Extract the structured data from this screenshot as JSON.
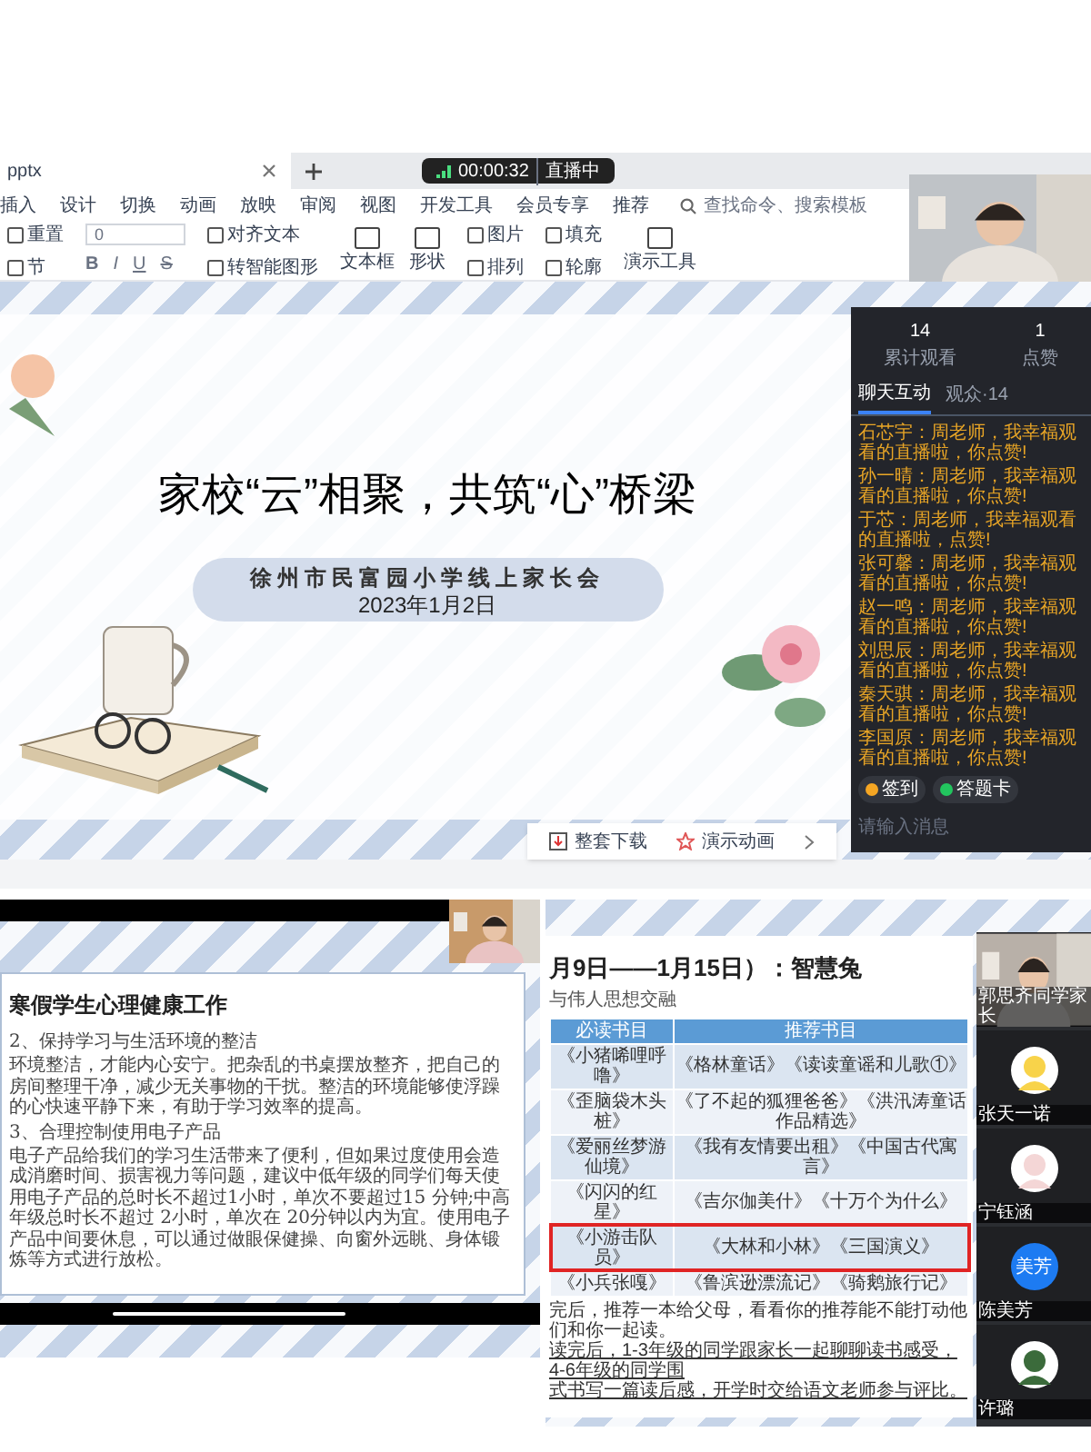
{
  "app": {
    "file_tab": "pptx",
    "live_badge": {
      "time": "00:00:32",
      "status": "直播中"
    },
    "menu": [
      "插入",
      "设计",
      "切换",
      "动画",
      "放映",
      "审阅",
      "视图",
      "开发工具",
      "会员专享",
      "推荐"
    ],
    "search_placeholder": "查找命令、搜索模板",
    "font_size": "0",
    "toolbar": [
      {
        "kind": "group",
        "items": [
          "重置",
          "节"
        ]
      },
      {
        "kind": "format",
        "items": [
          "B",
          "I",
          "U",
          "S"
        ]
      },
      {
        "kind": "group",
        "items": [
          "对齐文本",
          "转智能图形"
        ]
      },
      {
        "kind": "big",
        "items": [
          "文本框",
          "形状"
        ]
      },
      {
        "kind": "group",
        "items": [
          "图片",
          "排列"
        ]
      },
      {
        "kind": "group",
        "items": [
          "填充",
          "轮廓"
        ]
      },
      {
        "kind": "big",
        "items": [
          "演示工具"
        ]
      }
    ],
    "slide": {
      "title": "家校“云”相聚，共筑“心”桥梁",
      "school": "徐州市民富园小学线上家长会",
      "date": "2023年1月2日"
    },
    "slide_actions": [
      "整套下载",
      "演示动画"
    ],
    "live_panel": {
      "stats": [
        {
          "value": "14",
          "label": "累计观看"
        },
        {
          "value": "1",
          "label": "点赞"
        }
      ],
      "tabs": [
        {
          "label": "聊天互动",
          "selected": true
        },
        {
          "label": "观众·14",
          "selected": false
        }
      ],
      "messages": [
        {
          "sender": "石芯宇：",
          "text": "周老师，我幸福观看的直播啦，你点赞!"
        },
        {
          "sender": "孙一晴：",
          "text": "周老师，我幸福观看的直播啦，你点赞!"
        },
        {
          "sender": "于芯：",
          "text": "周老师，我幸福观看的直播啦，点赞!"
        },
        {
          "sender": "张可馨：",
          "text": "周老师，我幸福观看的直播啦，你点赞!"
        },
        {
          "sender": "赵一鸣：",
          "text": "周老师，我幸福观看的直播啦，你点赞!"
        },
        {
          "sender": "刘思辰：",
          "text": "周老师，我幸福观看的直播啦，你点赞!"
        },
        {
          "sender": "秦天骐：",
          "text": "周老师，我幸福观看的直播啦，你点赞!"
        },
        {
          "sender": "李国原：",
          "text": "周老师，我幸福观看的直播啦，你点赞!"
        }
      ],
      "actions": [
        {
          "label": "签到",
          "color": "#f5a623"
        },
        {
          "label": "答题卡",
          "color": "#22c55e"
        }
      ],
      "input_placeholder": "请输入消息"
    }
  },
  "left_share": {
    "title": "寒假学生心理健康工作",
    "sections": [
      {
        "heading": "2、保持学习与生活环境的整洁",
        "body": "环境整洁，才能内心安宁。把杂乱的书桌摆放整齐，把自己的房间整理干净，减少无关事物的干扰。整洁的环境能够使浮躁的心快速平静下来，有助于学习效率的提高。"
      },
      {
        "heading": "3、合理控制使用电子产品",
        "body": "电子产品给我们的学习生活带来了便利，但如果过度使用会造成消磨时间、损害视力等问题，建议中低年级的同学们每天使用电子产品的总时长不超过1小时，单次不要超过15 分钟;中高年级总时长不超过 2小时，单次在 20分钟以内为宜。使用电子产品中间要休息，可以通过做眼保健操、向窗外远眺、身体锻炼等方式进行放松。"
      }
    ]
  },
  "right_share": {
    "title": "月9日——1月15日）：智慧兔",
    "subtitle": "与伟人思想交融",
    "table": {
      "columns": [
        "必读书目",
        "推荐书目"
      ],
      "rows": [
        {
          "required": "《小猪唏哩呼噜》",
          "recommended": "《格林童话》《读读童谣和儿歌①》",
          "highlighted": false
        },
        {
          "required": "《歪脑袋木头桩》",
          "recommended": "《了不起的狐狸爸爸》《洪汛涛童话作品精选》",
          "highlighted": false
        },
        {
          "required": "《爱丽丝梦游仙境》",
          "recommended": "《我有友情要出租》《中国古代寓言》",
          "highlighted": false
        },
        {
          "required": "《闪闪的红星》",
          "recommended": "《吉尔伽美什》《十万个为什么》",
          "highlighted": false
        },
        {
          "required": "《小游击队员》",
          "recommended": "《大林和小林》《三国演义》",
          "highlighted": true
        },
        {
          "required": "《小兵张嘎》",
          "recommended": "《鲁滨逊漂流记》《骑鹅旅行记》",
          "highlighted": false
        }
      ]
    },
    "notes": [
      "完后，推荐一本给父母，看看你的推荐能不能打动他们和你一起读。",
      "读完后，1-3年级的同学跟家长一起聊聊读书感受，4-6年级的同学围",
      "式书写一篇读后感，开学时交给语文老师参与评比。"
    ],
    "participants": [
      {
        "kind": "camera",
        "name": "郭思齐同学家长"
      },
      {
        "kind": "avatar",
        "name": "张天一诺",
        "color": "#f8d34a"
      },
      {
        "kind": "avatar",
        "name": "宁钰涵",
        "color": "#f4d6d6"
      },
      {
        "kind": "initials",
        "name": "陈美芳",
        "initials": "美芳",
        "color": "#1d7bf2"
      },
      {
        "kind": "avatar",
        "name": "许璐",
        "color": "#3b6b3b"
      }
    ]
  }
}
